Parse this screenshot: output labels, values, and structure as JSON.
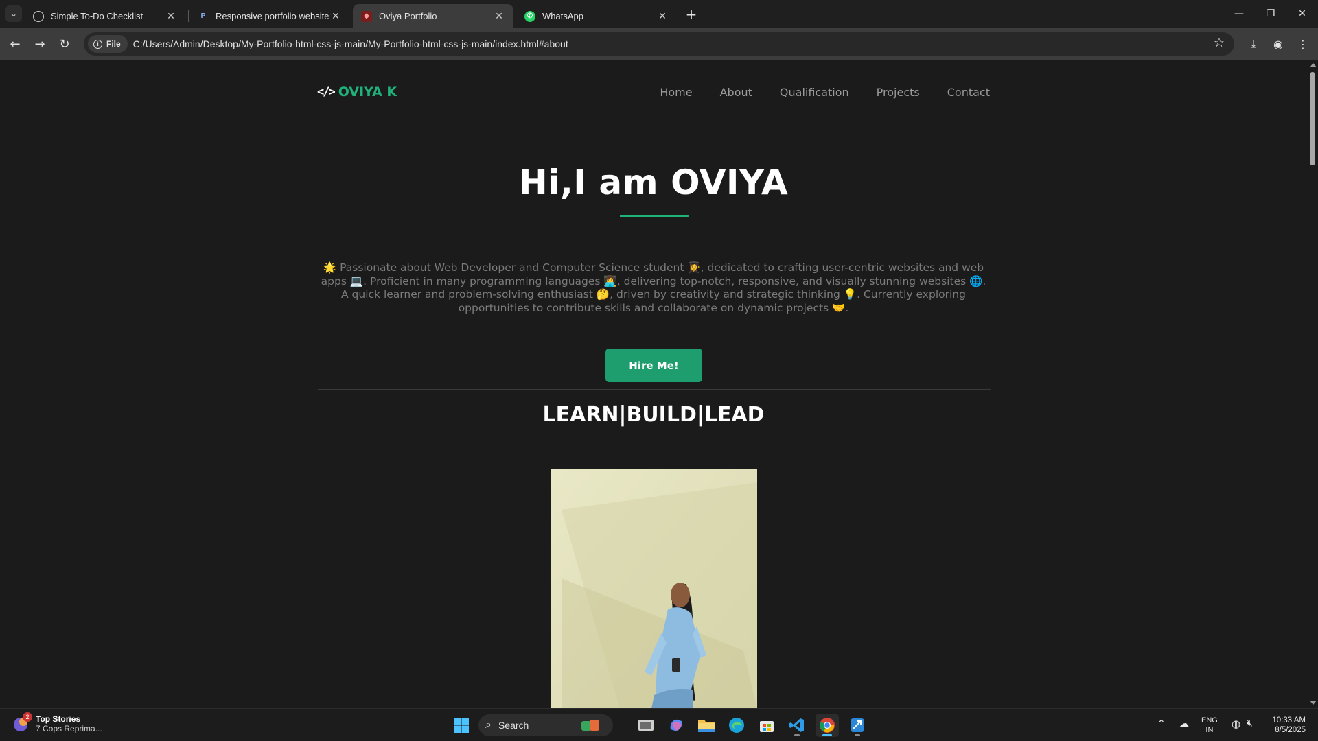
{
  "browser": {
    "tabs": [
      {
        "title": "Simple To-Do Checklist",
        "active": false
      },
      {
        "title": "Responsive portfolio website - I",
        "active": false
      },
      {
        "title": "Oviya Portfolio",
        "active": true
      },
      {
        "title": "WhatsApp",
        "active": false
      }
    ],
    "chip_label": "File",
    "url": "C:/Users/Admin/Desktop/My-Portfolio-html-css-js-main/My-Portfolio-html-css-js-main/index.html#about",
    "accent": "#3c3c3c"
  },
  "site": {
    "logo_text": "OVIYA K",
    "logo_icon": "</>",
    "nav": [
      "Home",
      "About",
      "Qualification",
      "Projects",
      "Contact"
    ],
    "hero_title": "Hi,I am OVIYA",
    "hero_text": "🌟 Passionate about Web Developer and Computer Science student 👩‍🎓, dedicated to crafting user-centric websites and web apps 💻. Proficient in many programming languages 👩‍💻, delivering top-notch, responsive, and visually stunning websites 🌐. A quick learner and problem-solving enthusiast 🤔, driven by creativity and strategic thinking 💡. Currently exploring opportunities to contribute skills and collaborate on dynamic projects 🤝.",
    "hire_button": "Hire Me!",
    "tagline": "LEARN|BUILD|LEAD",
    "accent_color": "#20b27b"
  },
  "taskbar": {
    "news_badge": "2",
    "news_title": "Top Stories",
    "news_sub": "7 Cops Reprima...",
    "search_placeholder": "Search",
    "lang_line1": "ENG",
    "lang_line2": "IN",
    "time": "10:33 AM",
    "date": "8/5/2025"
  }
}
